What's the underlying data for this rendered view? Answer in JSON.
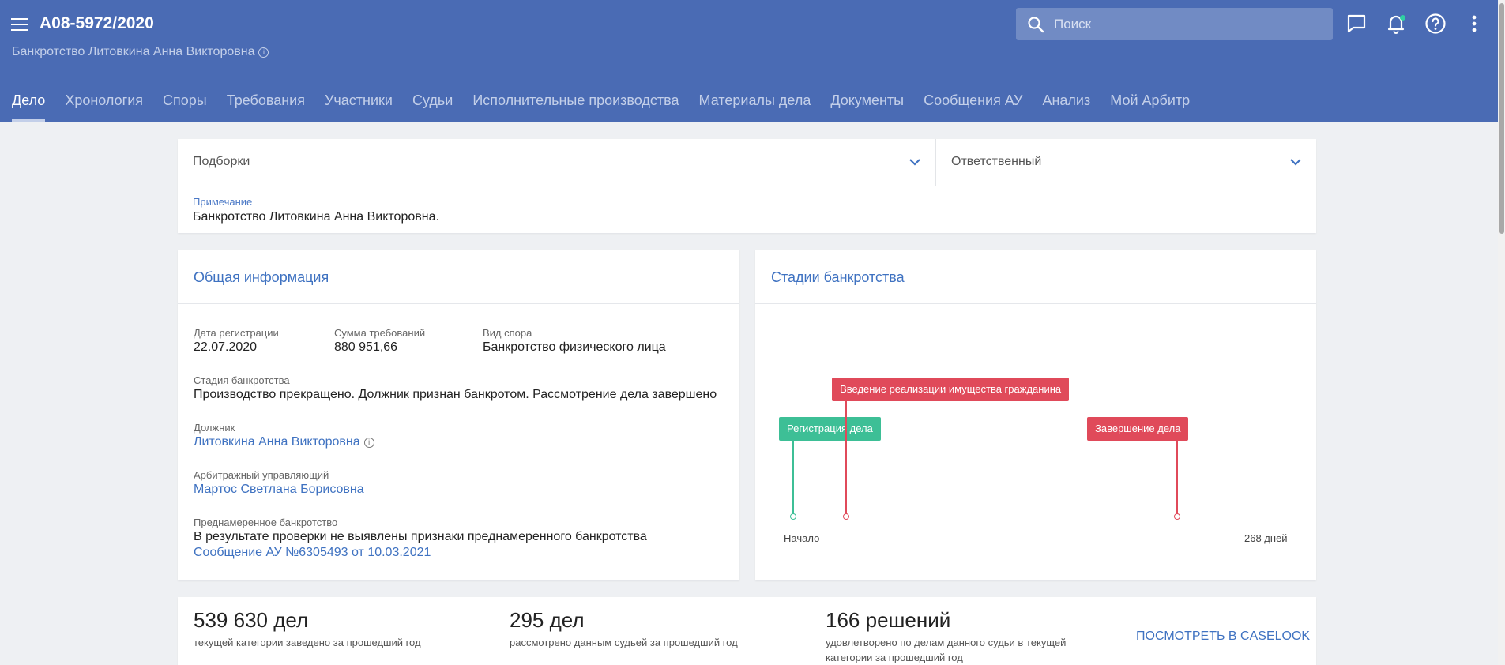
{
  "header": {
    "case_number": "А08-5972/2020",
    "subtitle": "Банкротство Литовкина Анна Викторовна",
    "search_placeholder": "Поиск"
  },
  "nav": {
    "tabs": [
      {
        "label": "Дело",
        "active": true
      },
      {
        "label": "Хронология"
      },
      {
        "label": "Споры"
      },
      {
        "label": "Требования"
      },
      {
        "label": "Участники"
      },
      {
        "label": "Судьи"
      },
      {
        "label": "Исполнительные производства"
      },
      {
        "label": "Материалы дела"
      },
      {
        "label": "Документы"
      },
      {
        "label": "Сообщения АУ"
      },
      {
        "label": "Анализ"
      },
      {
        "label": "Мой Арбитр"
      }
    ]
  },
  "filters": {
    "collections_label": "Подборки",
    "responsible_label": "Ответственный",
    "note_label": "Примечание",
    "note_text": "Банкротство Литовкина Анна Викторовна."
  },
  "general": {
    "title": "Общая информация",
    "reg_date_label": "Дата регистрации",
    "reg_date": "22.07.2020",
    "claims_sum_label": "Сумма требований",
    "claims_sum": "880 951,66",
    "dispute_type_label": "Вид спора",
    "dispute_type": "Банкротство физического лица",
    "stage_label": "Стадия банкротства",
    "stage": "Производство прекращено. Должник признан банкротом. Рассмотрение дела завершено",
    "debtor_label": "Должник",
    "debtor": "Литовкина Анна Викторовна",
    "manager_label": "Арбитражный управляющий",
    "manager": "Мартос Светлана Борисовна",
    "deliberate_label": "Преднамеренное банкротство",
    "deliberate_text": "В результате проверки не выявлены признаки преднамеренного банкротства",
    "deliberate_link": "Сообщение АУ №6305493 от 10.03.2021"
  },
  "stages": {
    "title": "Стадии банкротства",
    "start_label": "Начало",
    "end_label": "268 дней",
    "total_days": 268,
    "events": [
      {
        "label": "Регистрация дела",
        "day": 0,
        "color": "#3dbf96"
      },
      {
        "label": "Введение реализации имущества гражданина",
        "day": 37,
        "color": "#e04a5a"
      },
      {
        "label": "Завершение дела",
        "day": 268,
        "color": "#e04a5a"
      }
    ]
  },
  "stats": {
    "s1_value": "539 630 дел",
    "s1_desc": "текущей категории заведено за прошедший год",
    "s2_value": "295 дел",
    "s2_desc": "рассмотрено данным судьей за прошедший год",
    "s3_value": "166 решений",
    "s3_desc": "удовлетворено по делам данного судьи в текущей категории за прошедший год",
    "link": "ПОСМОТРЕТЬ В CASELOOK"
  }
}
